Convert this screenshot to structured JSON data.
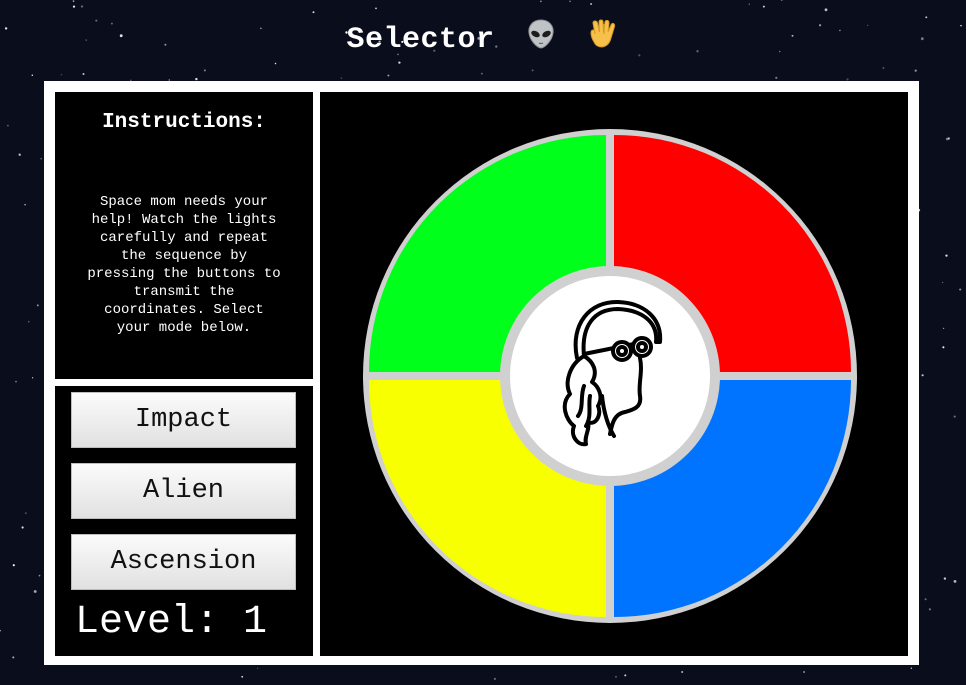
{
  "header": {
    "title": "Selector",
    "emoji_1": "alien-icon",
    "emoji_2": "vulcan-salute-icon"
  },
  "instructions": {
    "heading": "Instructions:",
    "body": "Space mom needs your help! Watch the lights carefully and repeat the sequence by pressing the buttons to transmit the coordinates. Select your mode below."
  },
  "modes": [
    {
      "label": "Impact"
    },
    {
      "label": "Alien"
    },
    {
      "label": "Ascension"
    }
  ],
  "level": {
    "text": "Level: 1"
  },
  "game": {
    "pads": [
      {
        "name": "green",
        "color": "#00ff1a"
      },
      {
        "name": "red",
        "color": "#ff0000"
      },
      {
        "name": "yellow",
        "color": "#f8ff00"
      },
      {
        "name": "blue",
        "color": "#0073ff"
      }
    ],
    "ring_color": "#d0d0d0",
    "center_icon": "space-mom-logo-icon"
  }
}
